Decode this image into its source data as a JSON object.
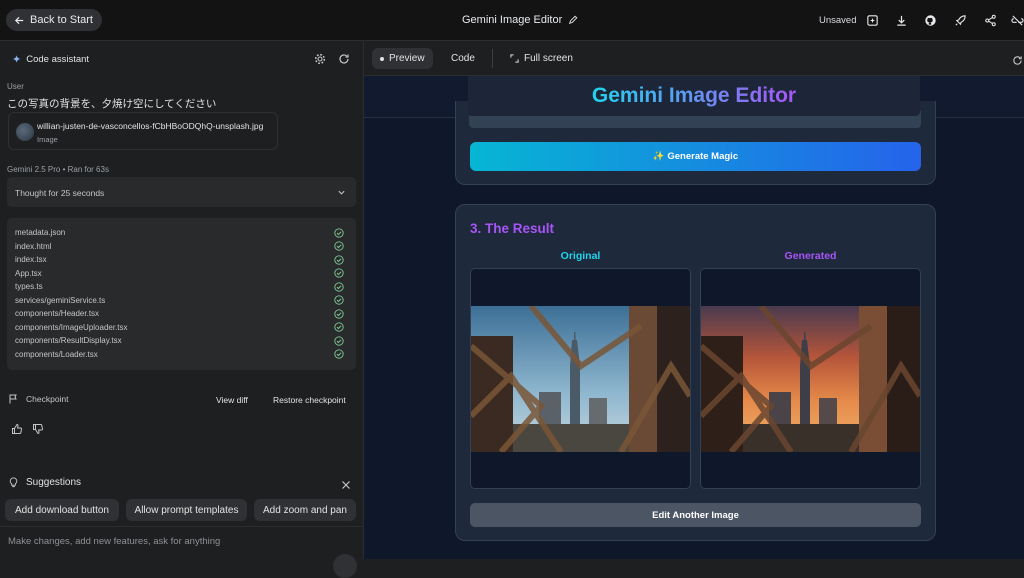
{
  "topbar": {
    "back_label": "Back to Start",
    "title": "Gemini Image Editor",
    "status": "Unsaved"
  },
  "assistant": {
    "header": "Code assistant",
    "role": "User",
    "message": "この写真の背景を、夕焼け空にしてください",
    "attachment": {
      "name": "willian-justen-de-vasconcellos-fCbHBoODQhQ-unsplash.jpg",
      "type": "Image"
    },
    "model_meta": "Gemini 2.5 Pro  •  Ran for 63s",
    "thought": "Thought for 25 seconds",
    "files": [
      "metadata.json",
      "index.html",
      "index.tsx",
      "App.tsx",
      "types.ts",
      "services/geminiService.ts",
      "components/Header.tsx",
      "components/ImageUploader.tsx",
      "components/ResultDisplay.tsx",
      "components/Loader.tsx"
    ],
    "checkpoint": "Checkpoint",
    "view_diff": "View diff",
    "restore": "Restore checkpoint",
    "suggestions_title": "Suggestions",
    "suggestions": [
      "Add download button",
      "Allow prompt templates",
      "Add zoom and pan"
    ],
    "prompt_placeholder": "Make changes, add new features, ask for anything"
  },
  "preview": {
    "tabs": [
      "Preview",
      "Code",
      "Full screen"
    ],
    "app_title": "Gemini Image Editor",
    "generate_label": "✨ Generate Magic",
    "result_title": "3. The Result",
    "original_label": "Original",
    "generated_label": "Generated",
    "edit_label": "Edit Another Image"
  },
  "colors": {
    "accent_cyan": "#22d3ee",
    "accent_purple": "#a855f7",
    "check_green": "#81c995"
  }
}
